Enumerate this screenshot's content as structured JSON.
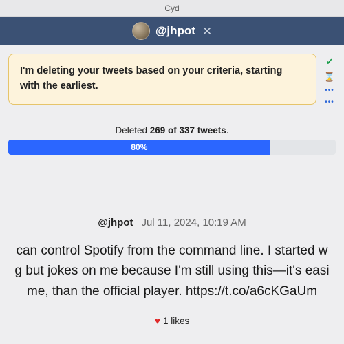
{
  "window": {
    "title": "Cyd"
  },
  "header": {
    "handle": "@jhpot"
  },
  "banner": {
    "message": "I'm deleting your tweets based on your criteria, starting with the earliest."
  },
  "side": {
    "check": "✔",
    "hour": "⌛",
    "dots1": "•••",
    "dots2": "•••"
  },
  "progress": {
    "prefix": "Deleted ",
    "count": "269 of 337 tweets",
    "suffix": ".",
    "percent": "80%",
    "fill_pct": 80
  },
  "tweet": {
    "user": "@jhpot",
    "date": "Jul 11, 2024, 10:19 AM",
    "line1": "can control Spotify from the command line. I started w",
    "line2": "g but jokes on me because I'm still using this—it's easi",
    "line3": "me, than the official player. https://t.co/a6cKGaUm"
  },
  "likes": {
    "icon": "♥",
    "text": "1 likes"
  }
}
